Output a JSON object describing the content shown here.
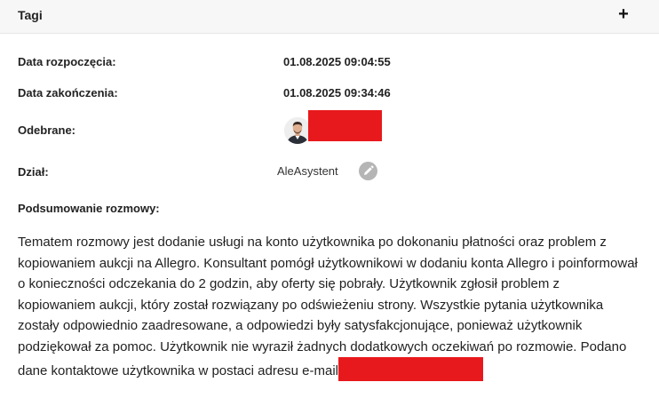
{
  "header": {
    "title": "Tagi",
    "expand_label": "+"
  },
  "details": {
    "start_label": "Data rozpoczęcia:",
    "start_value": "01.08.2025 09:04:55",
    "end_label": "Data zakończenia:",
    "end_value": "01.08.2025 09:34:46",
    "received_label": "Odebrane:",
    "department_label": "Dział:",
    "department_value": "AleAsystent"
  },
  "summary": {
    "label": "Podsumowanie rozmowy:",
    "text": "Tematem rozmowy jest dodanie usługi na konto użytkownika po dokonaniu płatności oraz problem z kopiowaniem aukcji na Allegro. Konsultant pomógł użytkownikowi w dodaniu konta Allegro i poinformował o konieczności odczekania do 2 godzin, aby oferty się pobrały. Użytkownik zgłosił problem z kopiowaniem aukcji, który został rozwiązany po odświeżeniu strony. Wszystkie pytania użytkownika zostały odpowiednio zaadresowane, a odpowiedzi były satysfakcjonujące, ponieważ użytkownik podziękował za pomoc. Użytkownik nie wyraził żadnych dodatkowych oczekiwań po rozmowie. Podano dane kontaktowe użytkownika w postaci adresu e-mail"
  },
  "colors": {
    "redaction": "#e8191c",
    "header_bg": "#f7f7f7",
    "edit_icon_bg": "#b5b5b5"
  },
  "icons": {
    "expand": "plus-icon",
    "edit": "pencil-icon",
    "avatar": "agent-avatar"
  }
}
